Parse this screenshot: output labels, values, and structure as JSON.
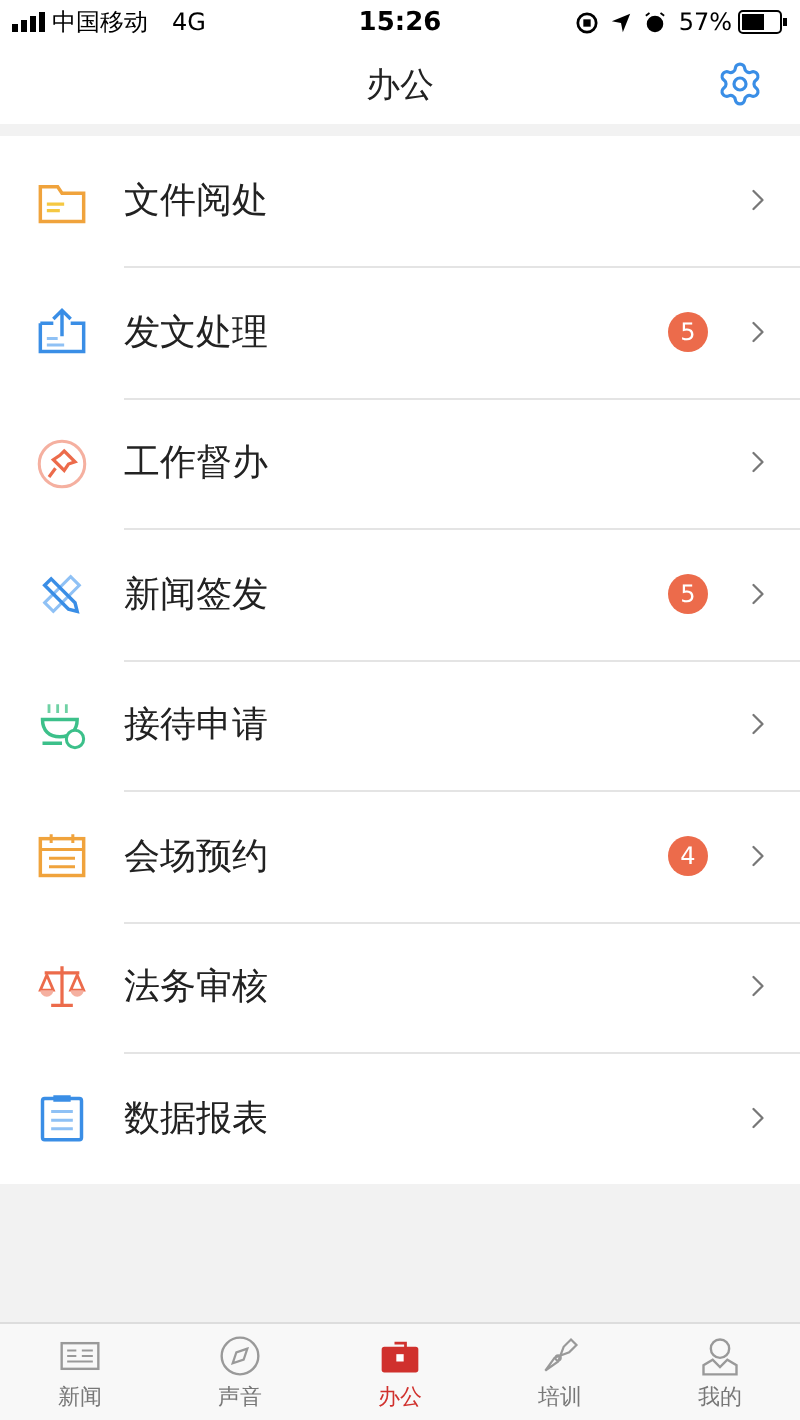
{
  "status_bar": {
    "carrier": "中国移动",
    "network": "4G",
    "time": "15:26",
    "battery": "57%"
  },
  "nav_bar": {
    "title": "办公"
  },
  "menu_items": [
    {
      "kind": "folder",
      "label": "文件阅处"
    },
    {
      "kind": "upload",
      "label": "发文处理",
      "badge": "5"
    },
    {
      "kind": "pin",
      "label": "工作督办"
    },
    {
      "kind": "pencil",
      "label": "新闻签发",
      "badge": "5"
    },
    {
      "kind": "cup",
      "label": "接待申请"
    },
    {
      "kind": "calendar",
      "label": "会场预约",
      "badge": "4"
    },
    {
      "kind": "scale",
      "label": "法务审核"
    },
    {
      "kind": "clipboard",
      "label": "数据报表"
    }
  ],
  "tab_bar": [
    {
      "kind": "news",
      "label": "新闻",
      "selected": false
    },
    {
      "kind": "compass",
      "label": "声音",
      "selected": false
    },
    {
      "kind": "briefcase",
      "label": "办公",
      "selected": true
    },
    {
      "kind": "pen",
      "label": "培训",
      "selected": false
    },
    {
      "kind": "person",
      "label": "我的",
      "selected": false
    }
  ]
}
